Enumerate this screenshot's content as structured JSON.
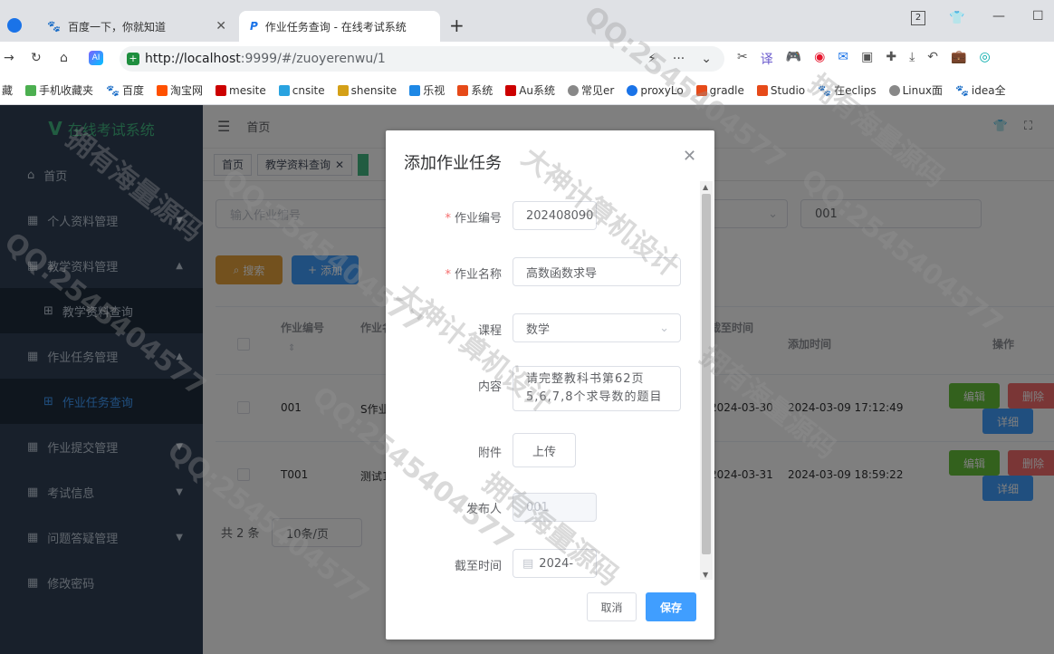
{
  "browser": {
    "tabs": [
      {
        "label": "百度一下，你就知道"
      },
      {
        "label": "作业任务查询 - 在线考试系统"
      }
    ],
    "tab_count": "2",
    "url_host": "http://localhost",
    "url_rest": ":9999/#/zuoyerenwu/1",
    "bookmarks": [
      "藏",
      "手机收藏夹",
      "百度",
      "淘宝网",
      "mesite",
      "cnsite",
      "shensite",
      "乐视",
      "系统",
      "Au系统",
      "常见er",
      "proxyLo",
      "gradle",
      "Studio",
      "在eclips",
      "Linux面",
      "idea全"
    ]
  },
  "sidebar": {
    "logo": "在线考试系统",
    "items": [
      {
        "label": "首页"
      },
      {
        "label": "个人资料管理"
      },
      {
        "label": "教学资料管理"
      },
      {
        "label": "教学资料查询"
      },
      {
        "label": "作业任务管理"
      },
      {
        "label": "作业任务查询"
      },
      {
        "label": "作业提交管理"
      },
      {
        "label": "考试信息"
      },
      {
        "label": "问题答疑管理"
      },
      {
        "label": "修改密码"
      }
    ]
  },
  "navbar": {
    "breadcrumb": "首页"
  },
  "tags": [
    "首页",
    "教学资料查询"
  ],
  "search": {
    "placeholder": "输入作业编号",
    "value_right": "001",
    "search_label": "搜索",
    "add_label": "添加"
  },
  "table": {
    "headers": [
      "作业编号",
      "作业名",
      "截至时间",
      "添加时间",
      "操作"
    ],
    "rows": [
      {
        "no": "001",
        "name": "S作业",
        "deadline": "2024-03-30",
        "added": "2024-03-09 17:12:49"
      },
      {
        "no": "T001",
        "name": "测试1",
        "deadline": "2024-03-31",
        "added": "2024-03-09 18:59:22"
      }
    ],
    "edit_label": "编辑",
    "delete_label": "删除",
    "detail_label": "详细"
  },
  "pagination": {
    "total": "共 2 条",
    "page_size": "10条/页"
  },
  "dialog": {
    "title": "添加作业任务",
    "fields": {
      "no_label": "作业编号",
      "no_value": "202408090",
      "name_label": "作业名称",
      "name_value": "高数函数求导",
      "course_label": "课程",
      "course_value": "数学",
      "content_label": "内容",
      "content_value": "请完整教科书第62页5,6,7,8个求导数的题目",
      "attach_label": "附件",
      "upload_label": "上传",
      "publisher_label": "发布人",
      "publisher_value": "001",
      "deadline_label": "截至时间",
      "deadline_value": "2024-"
    },
    "cancel_label": "取消",
    "save_label": "保存"
  },
  "watermarks": [
    "大神计算机设计",
    "QQ:2545404577",
    "拥有海量源码"
  ]
}
